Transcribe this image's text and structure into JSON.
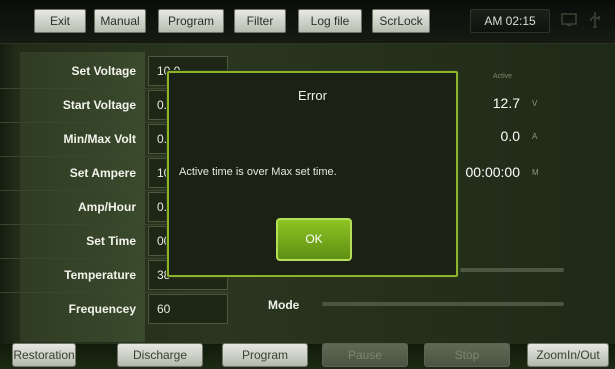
{
  "toolbar": {
    "exit": "Exit",
    "manual": "Manual",
    "program": "Program",
    "filter": "Filter",
    "log_file": "Log file",
    "scrlock": "ScrLock",
    "time": "AM 02:15"
  },
  "settings": {
    "rows": [
      {
        "label": "Set Voltage",
        "value": "10.0"
      },
      {
        "label": "Start Voltage",
        "value": "0."
      },
      {
        "label": "Min/Max Volt",
        "value": "0."
      },
      {
        "label": "Set Ampere",
        "value": "10"
      },
      {
        "label": "Amp/Hour",
        "value": "0."
      },
      {
        "label": "Set Time",
        "value": "00"
      },
      {
        "label": "Temperature",
        "value": "38"
      },
      {
        "label": "Frequencey",
        "value": "60"
      }
    ]
  },
  "readouts": {
    "header": "Active",
    "voltage": "12.7",
    "voltage_unit": "V",
    "ampere": "0.0",
    "ampere_unit": "A",
    "time": "00:00:00",
    "time_unit": "M"
  },
  "mode": {
    "label": "Mode"
  },
  "dialog": {
    "title": "Error",
    "message": "Active time is over Max set time.",
    "ok": "OK"
  },
  "bottom": {
    "restoration": "Restoration",
    "discharge": "Discharge",
    "program": "Program",
    "pause": "Pause",
    "stop": "Stop",
    "zoom": "ZoomIn/Out"
  },
  "colors": {
    "accent": "#8db32c",
    "panel": "#2a3620"
  }
}
